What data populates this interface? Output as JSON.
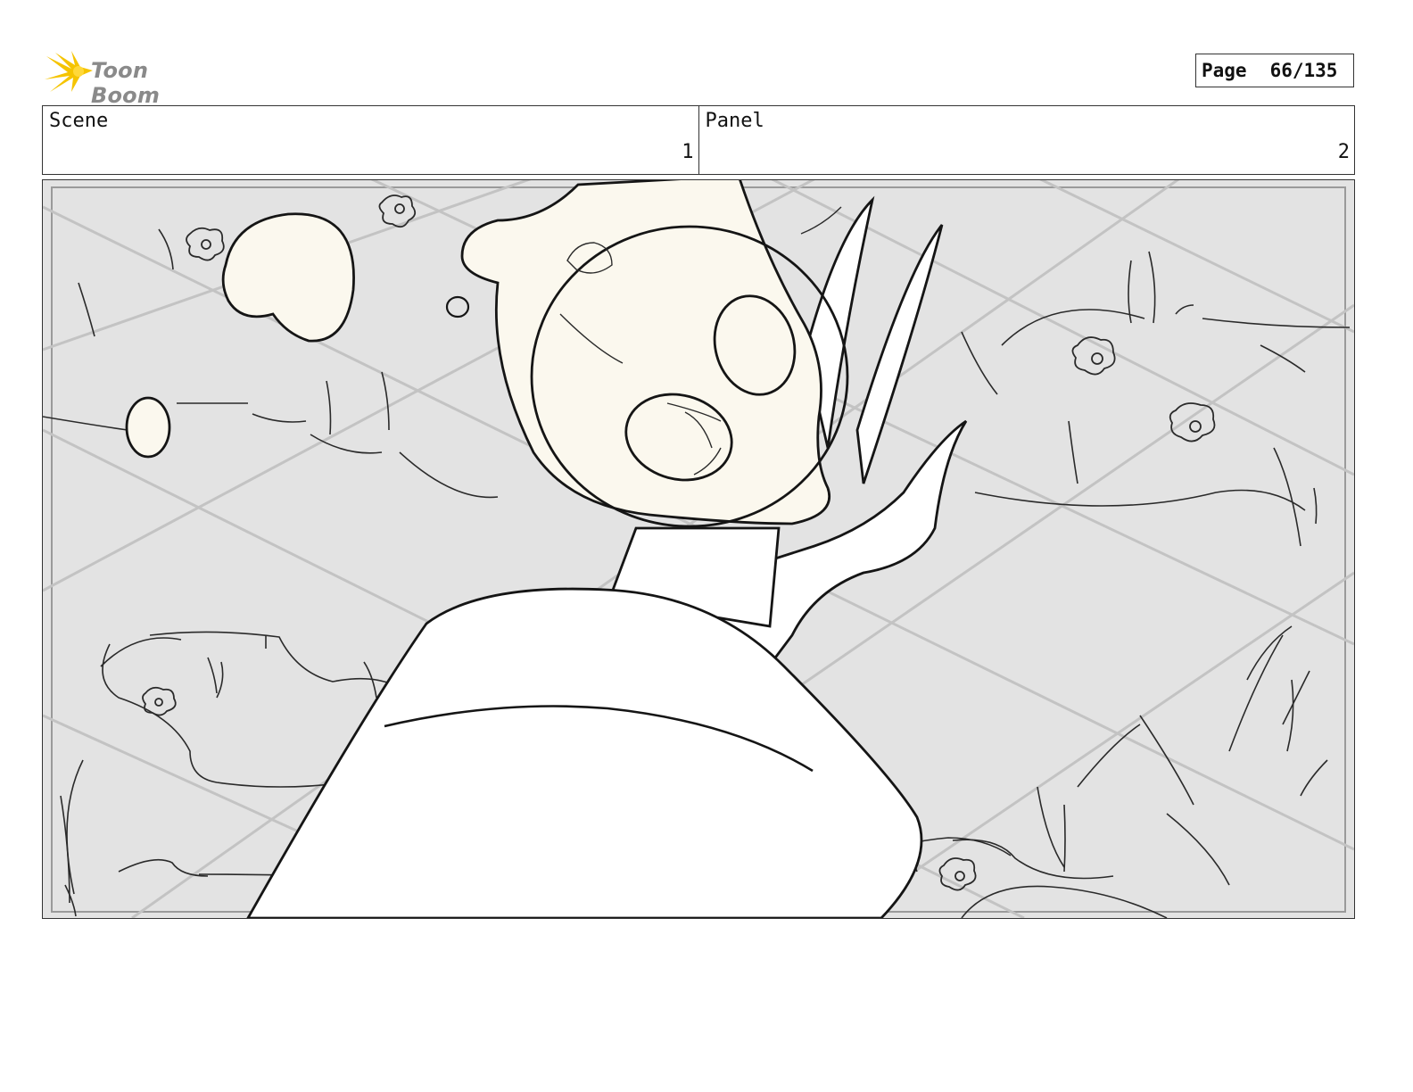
{
  "header": {
    "logo_text": "Toon Boom",
    "page_label": "Page",
    "page_number": "66/135"
  },
  "info": {
    "scene_label": "Scene",
    "scene_value": "1",
    "panel_label": "Panel",
    "panel_value": "2"
  },
  "colors": {
    "logo_yellow": "#f5c400",
    "logo_text": "#8a8a8a",
    "sketch_background": "#e3e3e3",
    "glow_fill": "#fbf8ee"
  }
}
